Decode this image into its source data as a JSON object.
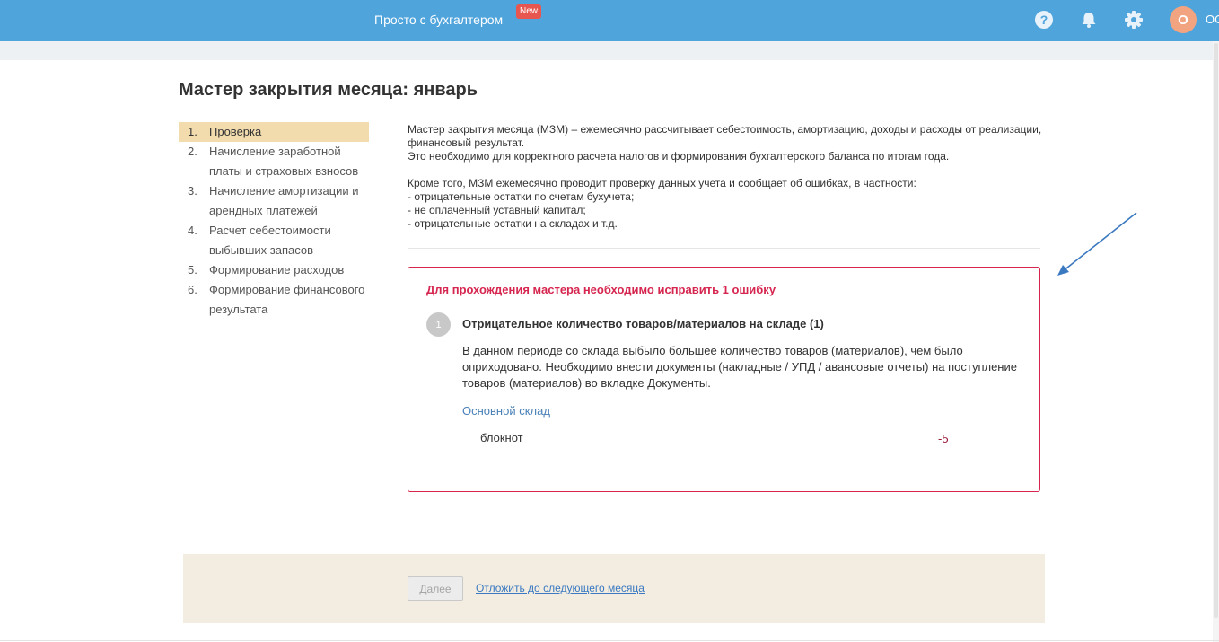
{
  "header": {
    "brand": "Просто с бухгалтером",
    "badge": "New",
    "avatar_letter": "О",
    "user_name": "ОО",
    "icons": [
      "help-icon",
      "bell-icon",
      "gear-icon"
    ],
    "colors": {
      "bar": "#4fa4dc",
      "badge": "#e8574f",
      "avatar": "#f2a480"
    }
  },
  "page": {
    "title": "Мастер закрытия месяца: январь"
  },
  "steps": [
    {
      "num": "1.",
      "label": "Проверка",
      "active": true
    },
    {
      "num": "2.",
      "label": "Начисление заработной платы и страховых взносов"
    },
    {
      "num": "3.",
      "label": "Начисление амортизации и арендных платежей"
    },
    {
      "num": "4.",
      "label": "Расчет себестоимости выбывших запасов"
    },
    {
      "num": "5.",
      "label": "Формирование расходов"
    },
    {
      "num": "6.",
      "label": "Формирование финансового результата"
    }
  ],
  "intro": {
    "p1": "Мастер закрытия месяца (МЗМ) – ежемесячно рассчитывает себестоимость, амортизацию, доходы и расходы от реализации, финансовый результат.",
    "p2": "Это необходимо для корректного расчета налогов и формирования бухгалтерского баланса по итогам года.",
    "p3": "Кроме того, МЗМ ежемесячно проводит проверку данных учета и сообщает об ошибках, в частности:",
    "bullets": [
      "- отрицательные остатки по счетам бухучета;",
      "- не оплаченный уставный капитал;",
      "- отрицательные остатки на складах и т.д."
    ]
  },
  "error": {
    "title": "Для прохождения мастера необходимо исправить 1 ошибку",
    "number": "1",
    "heading": "Отрицательное количество товаров/материалов на складе (1)",
    "description": "В данном периоде со склада выбыло большее количество товаров (материалов), чем было оприходовано. Необходимо внести документы (накладные / УПД / авансовые отчеты) на поступление товаров (материалов) во вкладке Документы.",
    "warehouse_link": "Основной склад",
    "item_name": "блокнот",
    "item_qty": "-5",
    "color": "#d6264f"
  },
  "footer": {
    "next_label": "Далее",
    "postpone_label": "Отложить до следующего месяца"
  }
}
